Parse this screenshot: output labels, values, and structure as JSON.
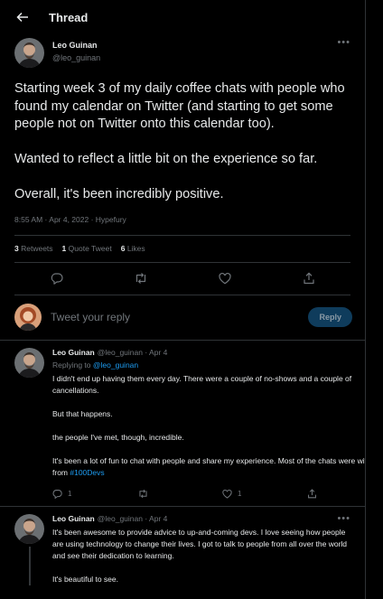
{
  "header": {
    "title": "Thread"
  },
  "main_tweet": {
    "author_name": "Leo Guinan",
    "author_handle": "@leo_guinan",
    "paragraphs": [
      "Starting week 3 of my daily coffee chats with people who found my calendar on Twitter (and starting to get some people not on Twitter onto this calendar too).",
      "Wanted to reflect a little bit on the experience so far.",
      "Overall, it's been incredibly positive."
    ],
    "timestamp": "8:55 AM · Apr 4, 2022 · Hypefury",
    "stats": {
      "retweets_count": "3",
      "retweets_label": "Retweets",
      "quotes_count": "1",
      "quotes_label": "Quote Tweet",
      "likes_count": "6",
      "likes_label": "Likes"
    }
  },
  "reply_box": {
    "placeholder": "Tweet your reply",
    "button_label": "Reply"
  },
  "replies": [
    {
      "author_name": "Leo Guinan",
      "meta": "@leo_guinan · Apr 4",
      "replying_prefix": "Replying to",
      "replying_to": "@leo_guinan",
      "paragraphs": [
        "I didn't end up having them every day. There were a couple of no-shows and a couple of cancellations.",
        "But that happens.",
        "the people I've met, though, incredible."
      ],
      "last_paragraph_text": "It's been a lot of fun to chat with people and share my experience. Most of the chats were with folks from ",
      "last_paragraph_hashtag": "#100Devs",
      "reply_count": "1",
      "like_count": "1"
    },
    {
      "author_name": "Leo Guinan",
      "meta": "@leo_guinan · Apr 4",
      "paragraphs": [
        "It's been awesome to provide advice to up-and-coming devs. I love seeing how people are using technology to change their lives. I got to talk to people from all over the world and see their dedication to learning.",
        "It's beautiful to see."
      ]
    }
  ],
  "icons": {
    "back": "arrow-left-icon",
    "more": "more-horizontal-icon",
    "reply": "reply-icon",
    "retweet": "retweet-icon",
    "like": "heart-icon",
    "share": "share-icon"
  },
  "colors": {
    "background": "#000000",
    "text": "#e7e9ea",
    "secondary": "#71767b",
    "accent": "#1d9bf0",
    "border": "#2f3336",
    "reply_button_bg": "#0f3c5c"
  }
}
